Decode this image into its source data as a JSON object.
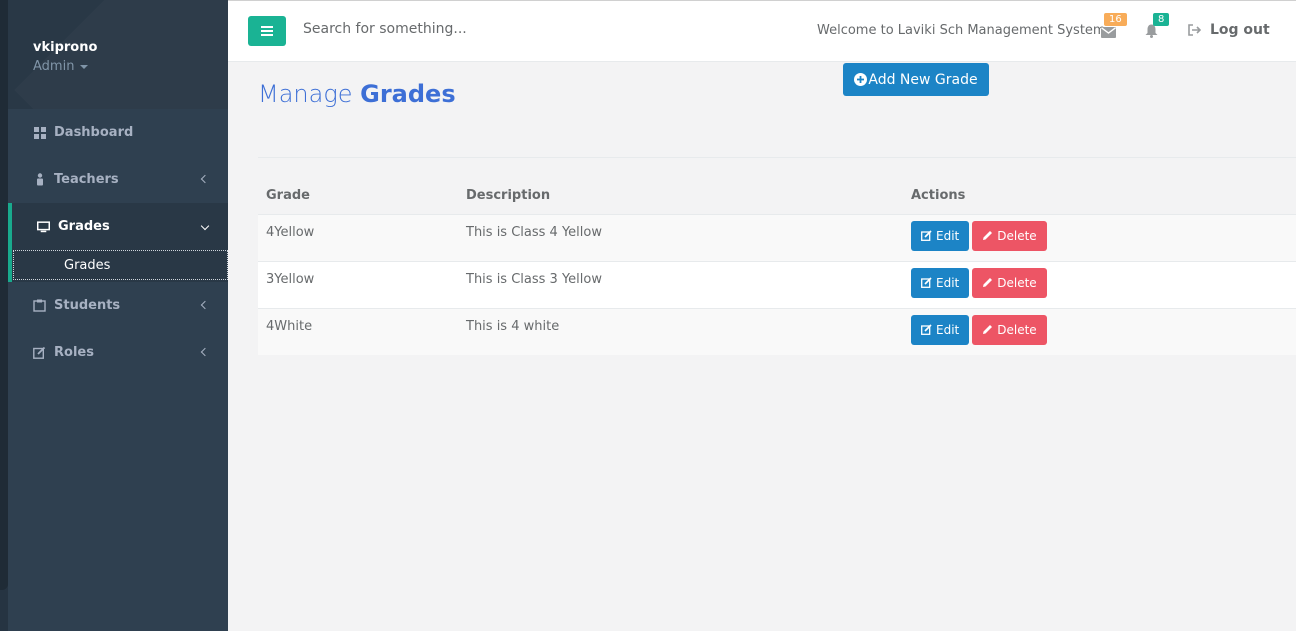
{
  "colors": {
    "sidebar": "#2f4050",
    "accent": "#1ab394",
    "primary": "#1c84c6",
    "danger": "#ed5565",
    "title": "#3d6fd6"
  },
  "profile": {
    "name": "vkiprono",
    "role": "Admin"
  },
  "sidebar": {
    "items": [
      {
        "label": "Dashboard",
        "icon": "dashboard-icon"
      },
      {
        "label": "Teachers",
        "icon": "user-icon"
      },
      {
        "label": "Grades",
        "icon": "desktop-icon"
      },
      {
        "label": "Students",
        "icon": "clipboard-icon"
      },
      {
        "label": "Roles",
        "icon": "edit-icon"
      }
    ],
    "sub_item": "Grades"
  },
  "topbar": {
    "search_placeholder": "Search for something...",
    "welcome": "Welcome to Laviki Sch Management System",
    "messages_count": "16",
    "alerts_count": "8",
    "logout": "Log out"
  },
  "page": {
    "title_light": "Manage",
    "title_bold": "Grades",
    "add_button": "Add New Grade"
  },
  "table": {
    "headers": [
      "Grade",
      "Description",
      "Actions"
    ],
    "rows": [
      {
        "grade": "4Yellow",
        "description": "This is Class 4 Yellow"
      },
      {
        "grade": "3Yellow",
        "description": "This is Class 3 Yellow"
      },
      {
        "grade": "4White",
        "description": "This is 4 white"
      }
    ],
    "edit_label": "Edit",
    "delete_label": "Delete"
  }
}
